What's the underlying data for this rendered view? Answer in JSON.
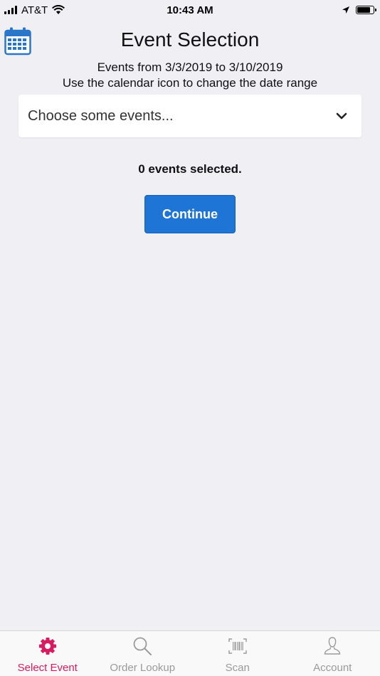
{
  "status_bar": {
    "carrier": "AT&T",
    "time": "10:43 AM",
    "battery_level": 0.85
  },
  "header": {
    "title": "Event Selection",
    "calendar_icon": "calendar-icon"
  },
  "date_range": {
    "line1": "Events from 3/3/2019 to 3/10/2019",
    "line2": "Use the calendar icon to change the date range"
  },
  "event_select": {
    "placeholder": "Choose some events...",
    "icon": "chevron-down-icon"
  },
  "selection": {
    "count_text": "0 events selected."
  },
  "actions": {
    "continue_label": "Continue"
  },
  "tabs": [
    {
      "label": "Select Event",
      "icon": "gear-icon",
      "active": true
    },
    {
      "label": "Order Lookup",
      "icon": "search-icon",
      "active": false
    },
    {
      "label": "Scan",
      "icon": "barcode-icon",
      "active": false
    },
    {
      "label": "Account",
      "icon": "user-icon",
      "active": false
    }
  ],
  "colors": {
    "accent": "#1f75d6",
    "active_tab": "#d81b60",
    "inactive_tab": "#9a9a9a",
    "background": "#efeff4"
  }
}
